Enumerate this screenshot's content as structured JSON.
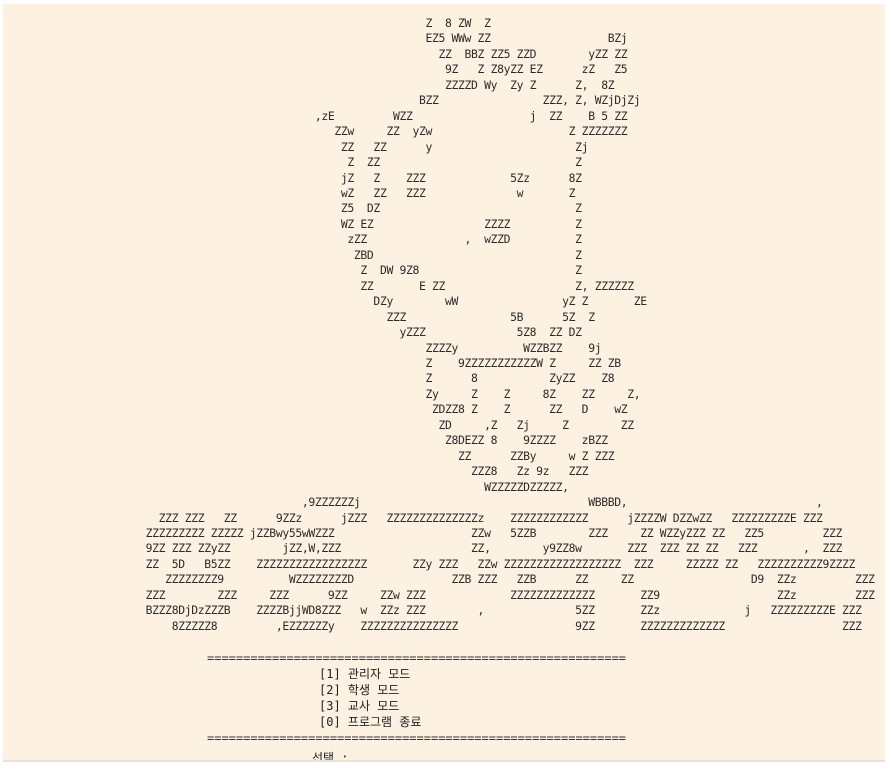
{
  "ascii_art_lines": [
    "                                                                Z  8 ZW  Z",
    "                                                                EZ5 WWw ZZ                  BZj",
    "                                                                  ZZ  BBZ ZZ5 ZZD        yZZ ZZ",
    "                                                                   9Z   Z Z8yZZ EZ      zZ   Z5",
    "                                                                   ZZZZD Wy  Zy Z      Z,  8Z",
    "                                                               BZZ                ZZZ, Z, WZjDjZj",
    "                                               ,zE         WZZ                  j  ZZ    B 5 ZZ",
    "                                                  ZZw     ZZ  yZw                     Z ZZZZZZZ",
    "                                                   ZZ   ZZ      y                      Zj",
    "                                                    Z  ZZ                              Z",
    "                                                   jZ   Z    ZZZ             5Zz      8Z",
    "                                                   wZ   ZZ   ZZZ              w       Z",
    "                                                   Z5  DZ                              Z",
    "                                                   WZ EZ                 ZZZZ          Z",
    "                                                    zZZ               ,  wZZD          Z",
    "                                                     ZBD                               Z",
    "                                                      Z  DW 9Z8                        Z",
    "                                                      ZZ       E ZZ                    Z, ZZZZZZ",
    "                                                        DZy        wW                yZ Z       ZE",
    "                                                          ZZZ                5B      5Z  Z",
    "                                                            yZZZ              5Z8  ZZ DZ",
    "                                                                ZZZZy          WZZBZZ    9j",
    "                                                                Z    9ZZZZZZZZZZZW Z     ZZ ZB",
    "                                                                Z      8           ZyZZ    Z8",
    "                                                                Zy     Z    Z     8Z    ZZ     Z,",
    "                                                                 ZDZZ8 Z    Z      ZZ   D    wZ",
    "                                                                  ZD     ,Z   Zj     Z        ZZ",
    "                                                                   Z8DEZZ 8    9ZZZZ    zBZZ",
    "                                                                     ZZ      ZZBy     w Z ZZZ",
    "                                                                       ZZZ8   Zz 9z   ZZZ",
    "                                                                         WZZZZZDZZZZZ,",
    "                                             ,9ZZZZZZj                                   WBBBD,                             ,",
    "                       ZZZ ZZZ   ZZ      9ZZz      jZZZ   ZZZZZZZZZZZZZZz    ZZZZZZZZZZZZ      jZZZZW DZZwZZ   ZZZZZZZZZE ZZZ",
    "                     ZZZZZZZZZ ZZZZZ jZZBwy55wWZZZ                     ZZw   5ZZB        ZZZ     ZZ WZZyZZZ ZZ   ZZ5         ZZZ",
    "                     9ZZ ZZZ ZZyZZ        jZZ,W,ZZZ                    ZZ,        y9ZZ8w       ZZZ  ZZZ ZZ ZZ   ZZZ       ,  ZZZ",
    "                     ZZ  5D   B5ZZ    ZZZZZZZZZZZZZZZZZ       ZZy ZZZ   ZZw ZZZZZZZZZZZZZZZZZZ  ZZZ     ZZZZZ ZZ   ZZZZZZZZZZ9ZZZZ",
    "                        ZZZZZZZZ9          WZZZZZZZZD               ZZB ZZZ   ZZB      ZZ     ZZ                  D9  ZZz         ZZZ",
    "                     ZZZ        ZZZ     ZZZ      9ZZ     ZZw ZZZ             ZZZZZZZZZZZZZ       ZZ9                  ZZz         ZZZ",
    "                     BZZZ8DjDzZZZB    ZZZZBjjWD8ZZZ   w  ZZz ZZZ        ,              5ZZ       ZZz             j   ZZZZZZZZZE ZZZ",
    "                         8ZZZZZ8         ,EZZZZZZy    ZZZZZZZZZZZZZZZ                  9ZZ       ZZZZZZZZZZZZZ                  ZZZ"
  ],
  "menu": {
    "separator_top": "==========================================================",
    "items": [
      "[1] 관리자 모드",
      "[2] 학생 모드",
      "[3] 교사 모드",
      "[0] 프로그램 종료"
    ],
    "separator_bottom": "==========================================================",
    "prompt": "선택 :"
  }
}
